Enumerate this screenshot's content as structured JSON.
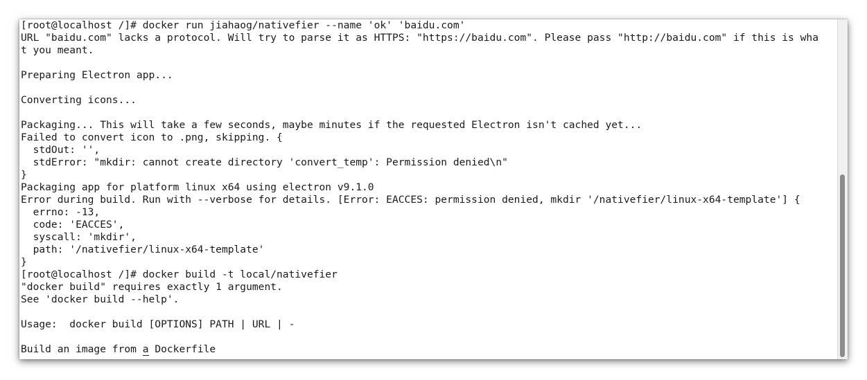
{
  "terminal": {
    "lines": [
      "[root@localhost /]# docker run jiahaog/nativefier --name 'ok' 'baidu.com'",
      "URL \"baidu.com\" lacks a protocol. Will try to parse it as HTTPS: \"https://baidu.com\". Please pass \"http://baidu.com\" if this is wha",
      "t you meant.",
      "",
      "Preparing Electron app...",
      "",
      "Converting icons...",
      "",
      "Packaging... This will take a few seconds, maybe minutes if the requested Electron isn't cached yet...",
      "Failed to convert icon to .png, skipping. {",
      "  stdOut: '',",
      "  stdError: \"mkdir: cannot create directory 'convert_temp': Permission denied\\n\"",
      "}",
      "Packaging app for platform linux x64 using electron v9.1.0",
      "Error during build. Run with --verbose for details. [Error: EACCES: permission denied, mkdir '/nativefier/linux-x64-template'] {",
      "  errno: -13,",
      "  code: 'EACCES',",
      "  syscall: 'mkdir',",
      "  path: '/nativefier/linux-x64-template'",
      "}",
      "[root@localhost /]# docker build -t local/nativefier",
      "\"docker build\" requires exactly 1 argument.",
      "See 'docker build --help'.",
      "",
      "Usage:  docker build [OPTIONS] PATH | URL | -",
      ""
    ],
    "last_line": {
      "before_cursor": "Build an image from ",
      "cursor_char": "a",
      "after_cursor": " Dockerfile"
    }
  },
  "scrollbar": {
    "position_fraction": 1.0
  }
}
